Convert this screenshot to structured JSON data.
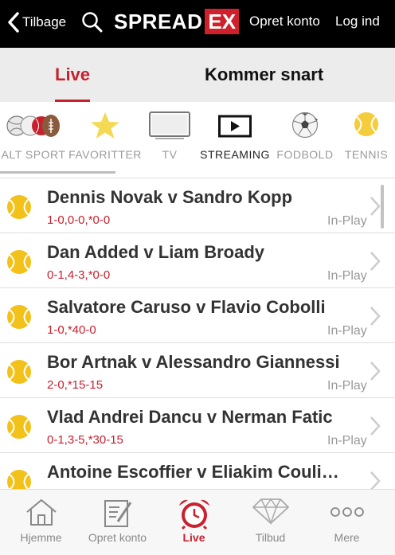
{
  "header": {
    "back_label": "Tilbage",
    "logo_part1": "SPREAD",
    "logo_part2": "EX",
    "create_account": "Opret konto",
    "login": "Log ind"
  },
  "tabs": [
    {
      "label": "Live",
      "active": true
    },
    {
      "label": "Kommer snart",
      "active": false
    }
  ],
  "sports": [
    {
      "label": "ALT SPORT",
      "icon": "all-sports-icon"
    },
    {
      "label": "FAVORITTER",
      "icon": "star-icon"
    },
    {
      "label": "TV",
      "icon": "tv-icon"
    },
    {
      "label": "STREAMING",
      "icon": "play-icon",
      "active": true
    },
    {
      "label": "FODBOLD",
      "icon": "football-icon"
    },
    {
      "label": "TENNIS",
      "icon": "tennis-ball-icon"
    }
  ],
  "events": [
    {
      "name": "Dennis Novak v Sandro Kopp",
      "score": "1-0,0-0,*0-0",
      "status": "In-Play"
    },
    {
      "name": "Dan Added v Liam Broady",
      "score": "0-1,4-3,*0-0",
      "status": "In-Play"
    },
    {
      "name": "Salvatore Caruso v Flavio Cobolli",
      "score": "1-0,*40-0",
      "status": "In-Play"
    },
    {
      "name": "Bor Artnak v Alessandro Giannessi",
      "score": "2-0,*15-15",
      "status": "In-Play"
    },
    {
      "name": "Vlad Andrei Dancu v Nerman Fatic",
      "score": "0-1,3-5,*30-15",
      "status": "In-Play"
    },
    {
      "name": "Antoine Escoffier v Eliakim Couli…",
      "score": "",
      "status": ""
    }
  ],
  "bottom_nav": [
    {
      "label": "Hjemme",
      "icon": "home-icon"
    },
    {
      "label": "Opret konto",
      "icon": "form-icon"
    },
    {
      "label": "Live",
      "icon": "alarm-clock-icon",
      "active": true
    },
    {
      "label": "Tilbud",
      "icon": "diamond-icon"
    },
    {
      "label": "Mere",
      "icon": "more-icon"
    }
  ],
  "colors": {
    "accent": "#c8202e",
    "topbar": "#000000",
    "tennis_ball": "#f2c21b"
  }
}
